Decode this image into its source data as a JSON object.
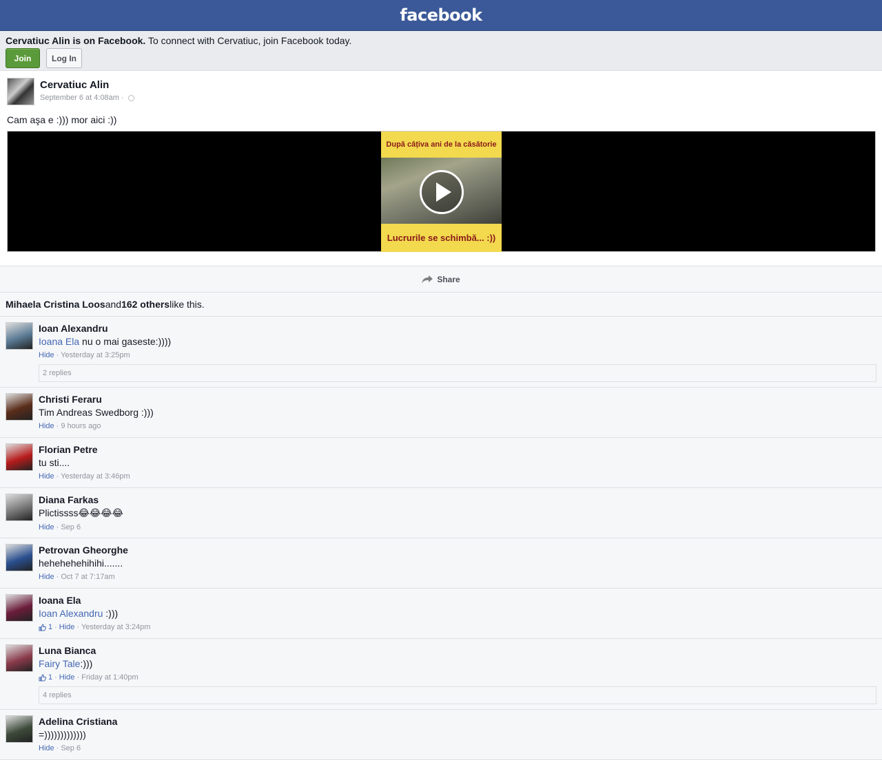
{
  "header": {
    "logo": "facebook"
  },
  "join_banner": {
    "name": "Cervatiuc Alin is on Facebook.",
    "text": " To connect with Cervatiuc, join Facebook today.",
    "join_label": "Join",
    "login_label": "Log In"
  },
  "post": {
    "author": "Cervatiuc Alin",
    "time": "September 6 at 4:08am ·",
    "text": "Cam aşa e :))) mor aici :))",
    "video_top": "După câțiva ani de la căsătorie",
    "video_bottom": "Lucrurile se schimbă... :))"
  },
  "share_label": "Share",
  "likes": {
    "first": "Mihaela Cristina Loos",
    "and": " and ",
    "others": "162 others",
    "suffix": " like this."
  },
  "comments": [
    {
      "name": "Ioan Alexandru",
      "mention": "Ioana Ela",
      "text": " nu o mai gaseste:))))",
      "likes": "",
      "hide": "Hide",
      "time": "· Yesterday at 3:25pm",
      "replies": "2 replies",
      "avatar_color": "#5a7a94"
    },
    {
      "name": "Christi Feraru",
      "mention": "",
      "text": "Tim Andreas Swedborg :)))",
      "likes": "",
      "hide": "Hide",
      "time": "· 9 hours ago",
      "replies": "",
      "avatar_color": "#5a2d1a"
    },
    {
      "name": "Florian Petre",
      "mention": "",
      "text": "tu sti....",
      "likes": "",
      "hide": "Hide",
      "time": "· Yesterday at 3:46pm",
      "replies": "",
      "avatar_color": "#b71c1c"
    },
    {
      "name": "Diana Farkas",
      "mention": "",
      "text": "Plictissss😂😂😂😂",
      "likes": "",
      "hide": "Hide",
      "time": "· Sep 6",
      "replies": "",
      "avatar_color": "#777777"
    },
    {
      "name": "Petrovan Gheorghe",
      "mention": "",
      "text": "hehehehehihihi.......",
      "likes": "",
      "hide": "Hide",
      "time": "· Oct 7 at 7:17am",
      "replies": "",
      "avatar_color": "#2a4f8f"
    },
    {
      "name": "Ioana Ela",
      "mention": "Ioan Alexandru",
      "text": " :)))",
      "likes": "1",
      "hide": "Hide",
      "time": "· Yesterday at 3:24pm",
      "replies": "",
      "avatar_color": "#6b1d3a"
    },
    {
      "name": "Luna Bianca",
      "mention": "Fairy Tale",
      "text": ":)))",
      "likes": "1",
      "hide": "Hide",
      "time": "· Friday at 1:40pm",
      "replies": "4 replies",
      "avatar_color": "#8a3a4a"
    },
    {
      "name": "Adelina Cristiana",
      "mention": "",
      "text": "=)))))))))))))",
      "likes": "",
      "hide": "Hide",
      "time": "· Sep 6",
      "replies": "",
      "avatar_color": "#3d4a3a"
    }
  ]
}
